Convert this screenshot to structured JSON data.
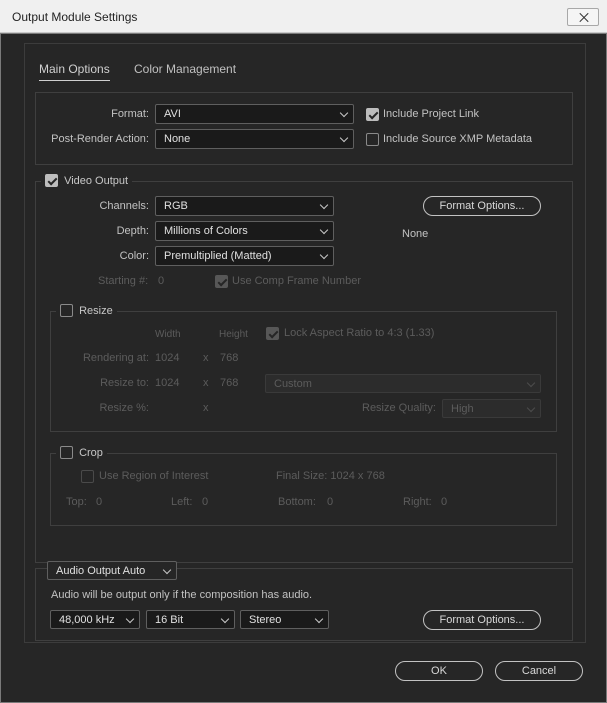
{
  "window": {
    "title": "Output Module Settings"
  },
  "tabs": [
    {
      "label": "Main Options"
    },
    {
      "label": "Color Management"
    }
  ],
  "format": {
    "format_label": "Format:",
    "format_value": "AVI",
    "post_render_label": "Post-Render Action:",
    "post_render_value": "None",
    "include_project_link": "Include Project Link",
    "include_source_xmp": "Include Source XMP Metadata"
  },
  "video": {
    "title": "Video Output",
    "channels_label": "Channels:",
    "channels_value": "RGB",
    "depth_label": "Depth:",
    "depth_value": "Millions of Colors",
    "color_label": "Color:",
    "color_value": "Premultiplied (Matted)",
    "format_options_button": "Format Options...",
    "codec_info": "None",
    "starting_label": "Starting #:",
    "starting_value": "0",
    "use_comp_frame": "Use Comp Frame Number"
  },
  "resize": {
    "title": "Resize",
    "width_header": "Width",
    "height_header": "Height",
    "lock_aspect": "Lock Aspect Ratio to 4:3 (1.33)",
    "rendering_at_label": "Rendering at:",
    "rendering_w": "1024",
    "rendering_h": "768",
    "resize_to_label": "Resize to:",
    "resize_w": "1024",
    "resize_h": "768",
    "resize_preset": "Custom",
    "resize_pct_label": "Resize %:",
    "times": "x",
    "resize_quality_label": "Resize Quality:",
    "resize_quality_value": "High"
  },
  "crop": {
    "title": "Crop",
    "use_roi": "Use Region of Interest",
    "final_size": "Final Size: 1024 x 768",
    "top_label": "Top:",
    "top_value": "0",
    "left_label": "Left:",
    "left_value": "0",
    "bottom_label": "Bottom:",
    "bottom_value": "0",
    "right_label": "Right:",
    "right_value": "0"
  },
  "audio": {
    "mode": "Audio Output Auto",
    "note": "Audio will be output only if the composition has audio.",
    "rate": "48,000 kHz",
    "bits": "16 Bit",
    "channels": "Stereo",
    "format_options_button": "Format Options..."
  },
  "footer": {
    "ok": "OK",
    "cancel": "Cancel"
  }
}
